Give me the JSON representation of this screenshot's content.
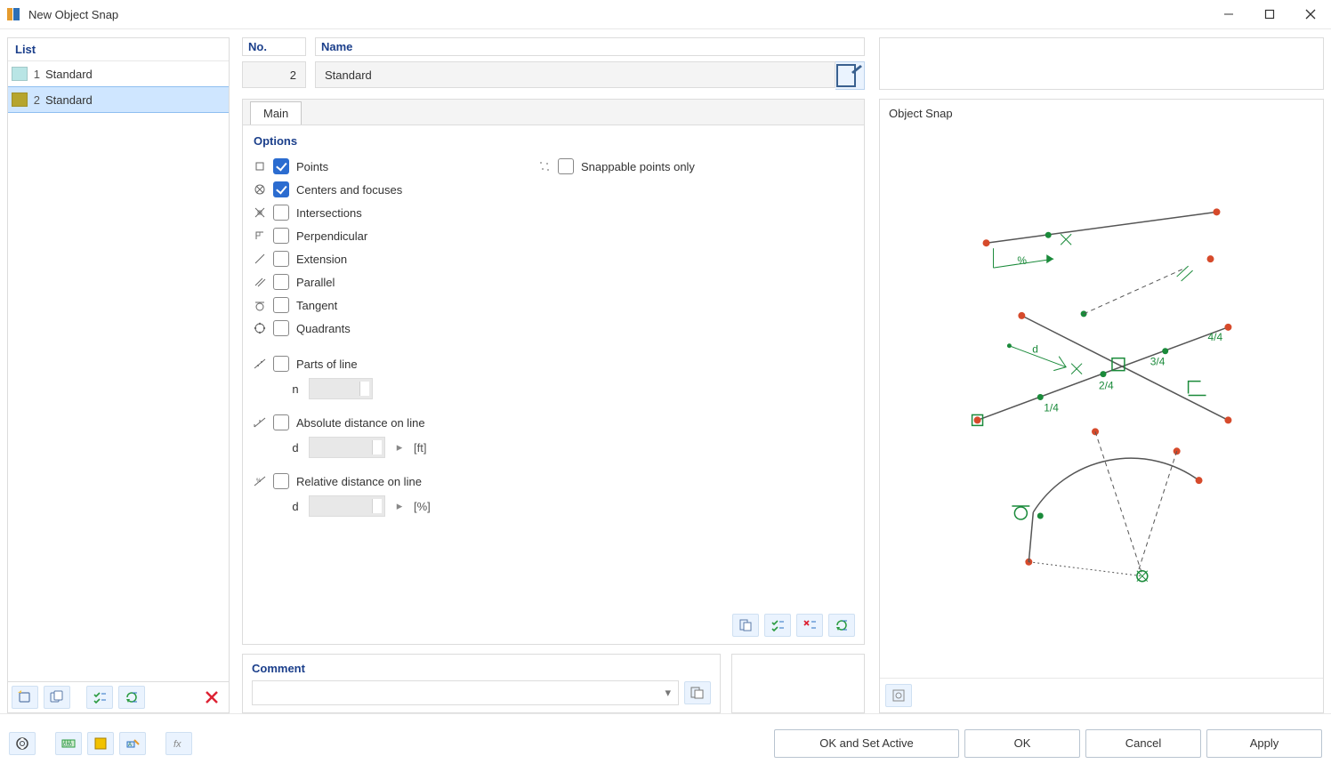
{
  "window": {
    "title": "New Object Snap"
  },
  "list": {
    "header": "List",
    "items": [
      {
        "no": "1",
        "name": "Standard",
        "color": "#b9e5e5"
      },
      {
        "no": "2",
        "name": "Standard",
        "color": "#b6a52e"
      }
    ],
    "selected_index": 1
  },
  "form": {
    "no_label": "No.",
    "no_value": "2",
    "name_label": "Name",
    "name_value": "Standard"
  },
  "tabs": {
    "main": "Main"
  },
  "options": {
    "title": "Options",
    "points": {
      "label": "Points",
      "checked": true
    },
    "centers": {
      "label": "Centers and focuses",
      "checked": true
    },
    "intersections": {
      "label": "Intersections",
      "checked": false
    },
    "perpendicular": {
      "label": "Perpendicular",
      "checked": false
    },
    "extension": {
      "label": "Extension",
      "checked": false
    },
    "parallel": {
      "label": "Parallel",
      "checked": false
    },
    "tangent": {
      "label": "Tangent",
      "checked": false
    },
    "quadrants": {
      "label": "Quadrants",
      "checked": false
    },
    "parts_of_line": {
      "label": "Parts of line",
      "checked": false,
      "param": "n",
      "value": ""
    },
    "abs_dist": {
      "label": "Absolute distance on line",
      "checked": false,
      "param": "d",
      "value": "",
      "unit": "[ft]"
    },
    "rel_dist": {
      "label": "Relative distance on line",
      "checked": false,
      "param": "d",
      "value": "",
      "unit": "[%]"
    },
    "snappable_only": {
      "label": "Snappable points only",
      "checked": false
    }
  },
  "comment": {
    "label": "Comment",
    "value": ""
  },
  "preview": {
    "title": "Object Snap",
    "labels": {
      "pct": "%",
      "d": "d",
      "q1": "1/4",
      "q2": "2/4",
      "q3": "3/4",
      "q4": "4/4"
    }
  },
  "buttons": {
    "ok_set_active": "OK and Set Active",
    "ok": "OK",
    "cancel": "Cancel",
    "apply": "Apply"
  }
}
